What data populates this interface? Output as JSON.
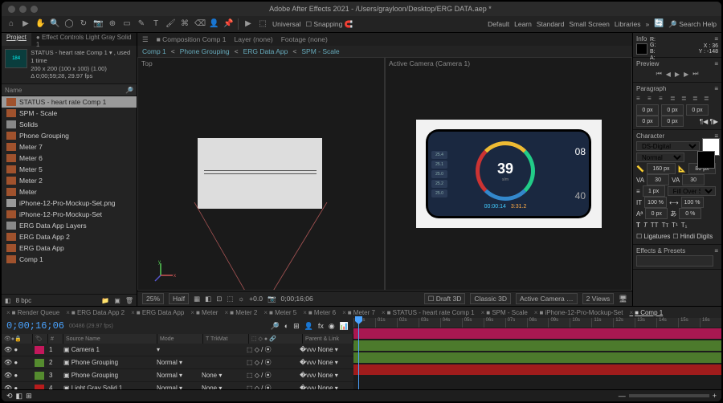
{
  "titlebar": {
    "title": "Adobe After Effects 2021 - /Users/grayloon/Desktop/ERG DATA.aep *"
  },
  "toolbar": {
    "workspaces": [
      "Default",
      "Learn",
      "Standard",
      "Small Screen",
      "Libraries"
    ],
    "snapping": "Snapping",
    "universal": "Universal",
    "search": "Search Help"
  },
  "project": {
    "tabs": {
      "project": "Project",
      "effect": "Effect Controls Light Gray Solid 1"
    },
    "thumbMeta": {
      "name": "STATUS - heart rate Comp 1 ▾ , used 1 time",
      "line2": "200 x 200 (100 x 100) (1.00)",
      "line3": "Δ 0;00;59;28, 29.97 fps"
    },
    "nameHdr": "Name",
    "items": [
      {
        "icon": "comp",
        "label": "STATUS - heart rate Comp 1",
        "sel": true
      },
      {
        "icon": "comp",
        "label": "SPM - Scale"
      },
      {
        "icon": "folder",
        "label": "Solids"
      },
      {
        "icon": "comp",
        "label": "Phone Grouping"
      },
      {
        "icon": "comp",
        "label": "Meter 7"
      },
      {
        "icon": "comp",
        "label": "Meter 6"
      },
      {
        "icon": "comp",
        "label": "Meter 5"
      },
      {
        "icon": "comp",
        "label": "Meter 2"
      },
      {
        "icon": "comp",
        "label": "Meter"
      },
      {
        "icon": "file",
        "label": "iPhone-12-Pro-Mockup-Set.png"
      },
      {
        "icon": "comp",
        "label": "iPhone-12-Pro-Mockup-Set"
      },
      {
        "icon": "folder",
        "label": "ERG Data App Layers"
      },
      {
        "icon": "comp",
        "label": "ERG Data App 2"
      },
      {
        "icon": "comp",
        "label": "ERG Data App"
      },
      {
        "icon": "comp",
        "label": "Comp 1"
      }
    ],
    "foot": {
      "bpc": "8 bpc"
    }
  },
  "viewer": {
    "tabs": {
      "composition": "Composition Comp 1",
      "layer": "Layer (none)",
      "footage": "Footage (none)"
    },
    "crumbs": [
      "Comp 1",
      "Phone Grouping",
      "ERG Data App",
      "SPM - Scale"
    ],
    "top": "Top",
    "cam": "Active Camera (Camera 1)",
    "phone": {
      "pills": [
        "25.4",
        "25.1",
        "25.0",
        "25.2",
        "25.0"
      ],
      "ringVal": "39",
      "ringUnit": "s/m",
      "t1": "00:00:14",
      "t2": "3:31.2",
      "r1": "08",
      "r2": "40"
    },
    "foot": {
      "zoom": "25%",
      "res": "Half",
      "exp": "+0.0",
      "time": "0;00;16;06",
      "draft": "Draft 3D",
      "renderer": "Classic 3D",
      "camera": "Active Camera …",
      "views": "2 Views"
    }
  },
  "right": {
    "info": {
      "hdr": "Info",
      "x": "X : 36",
      "y": "Y : -148"
    },
    "preview": {
      "hdr": "Preview"
    },
    "paragraph": {
      "hdr": "Paragraph",
      "vals": [
        "0 px",
        "0 px",
        "0 px",
        "0 px",
        "0 px"
      ]
    },
    "character": {
      "hdr": "Character",
      "font": "DS-Digital",
      "style": "Normal",
      "size": "160 px",
      "lead": "80 px",
      "kern": "30",
      "track": "30",
      "stroke": "1 px",
      "strokeFill": "Fill Over Stroke",
      "vs": "100 %",
      "hs": "100 %",
      "baseline": "0 px",
      "tsume": "0 %",
      "lig": "Ligatures",
      "digits": "Hindi Digits"
    },
    "fx": {
      "hdr": "Effects & Presets"
    }
  },
  "timeline": {
    "tabs": [
      "Render Queue",
      "ERG Data App 2",
      "ERG Data App",
      "Meter",
      "Meter 2",
      "Meter 5",
      "Meter 6",
      "Meter 7",
      "STATUS - heart rate Comp 1",
      "SPM - Scale",
      "iPhone-12-Pro-Mockup-Set",
      "Comp 1"
    ],
    "activeTab": 11,
    "timecode": "0;00;16;06",
    "frames": "00486 (29.97 fps)",
    "cols": {
      "num": "#",
      "src": "Source Name",
      "mode": "Mode",
      "trk": "T  TrkMat",
      "parent": "Parent & Link"
    },
    "ruler": [
      ":00s",
      "01s",
      "02s",
      "03s",
      "04s",
      "05s",
      "06s",
      "07s",
      "08s",
      "09s",
      "10s",
      "11s",
      "12s",
      "13s",
      "14s",
      "15s",
      "16s"
    ],
    "layers": [
      {
        "n": "1",
        "col": "#c2185b",
        "name": "Camera 1",
        "mode": "",
        "trk": "",
        "parent": "None"
      },
      {
        "n": "2",
        "col": "#558b2f",
        "name": "Phone Grouping",
        "mode": "Normal",
        "trk": "",
        "parent": "None"
      },
      {
        "n": "3",
        "col": "#558b2f",
        "name": "Phone Grouping",
        "mode": "Normal",
        "trk": "None",
        "parent": "None"
      },
      {
        "n": "4",
        "col": "#b71c1c",
        "name": "Light Gray Solid 1",
        "mode": "Normal",
        "trk": "None",
        "parent": "None"
      }
    ]
  }
}
